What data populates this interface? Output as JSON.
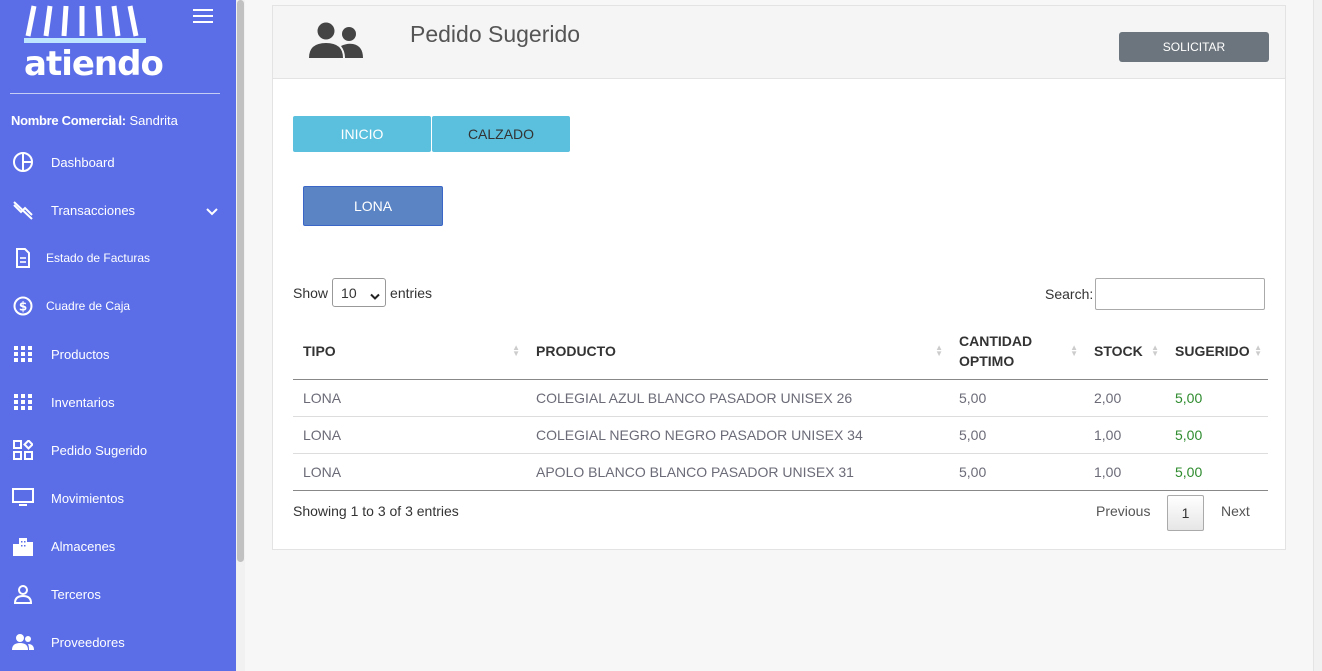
{
  "brand": {
    "logo_text": "atiendo"
  },
  "sidebar": {
    "commercial_label": "Nombre Comercial:",
    "commercial_value": "Sandrita",
    "items": [
      {
        "label": "Dashboard",
        "icon": "dashboard-icon"
      },
      {
        "label": "Transacciones",
        "icon": "transactions-icon"
      },
      {
        "label": "Estado de Facturas",
        "icon": "invoice-icon"
      },
      {
        "label": "Cuadre de Caja",
        "icon": "dollar-icon"
      },
      {
        "label": "Productos",
        "icon": "grid-icon"
      },
      {
        "label": "Inventarios",
        "icon": "grid-icon"
      },
      {
        "label": "Pedido Sugerido",
        "icon": "widgets-icon"
      },
      {
        "label": "Movimientos",
        "icon": "monitor-icon"
      },
      {
        "label": "Almacenes",
        "icon": "building-icon"
      },
      {
        "label": "Terceros",
        "icon": "person-icon"
      },
      {
        "label": "Proveedores",
        "icon": "people-icon"
      }
    ]
  },
  "header": {
    "title": "Pedido Sugerido",
    "solicitar_label": "SOLICITAR"
  },
  "breadcrumbs": {
    "inicio": "INICIO",
    "calzado": "CALZADO"
  },
  "category_button": "LONA",
  "table_controls": {
    "show_label": "Show",
    "entries_label": "entries",
    "page_size": "10",
    "search_label": "Search:",
    "search_value": ""
  },
  "table": {
    "columns": [
      "TIPO",
      "PRODUCTO",
      "CANTIDAD OPTIMO",
      "STOCK",
      "SUGERIDO"
    ],
    "rows": [
      {
        "tipo": "LONA",
        "producto": "COLEGIAL AZUL BLANCO PASADOR UNISEX 26",
        "cantidad": "5,00",
        "stock": "2,00",
        "sugerido": "5,00"
      },
      {
        "tipo": "LONA",
        "producto": "COLEGIAL NEGRO NEGRO PASADOR UNISEX 34",
        "cantidad": "5,00",
        "stock": "1,00",
        "sugerido": "5,00"
      },
      {
        "tipo": "LONA",
        "producto": "APOLO BLANCO BLANCO PASADOR UNISEX 31",
        "cantidad": "5,00",
        "stock": "1,00",
        "sugerido": "5,00"
      }
    ]
  },
  "pagination": {
    "info": "Showing 1 to 3 of 3 entries",
    "previous": "Previous",
    "page": "1",
    "next": "Next"
  },
  "colors": {
    "sidebar": "#5b6ee8",
    "info_button": "#5bc0de",
    "primary_button": "#5b84c4",
    "secondary_button": "#6c757d",
    "positive": "#2e8b2e"
  }
}
